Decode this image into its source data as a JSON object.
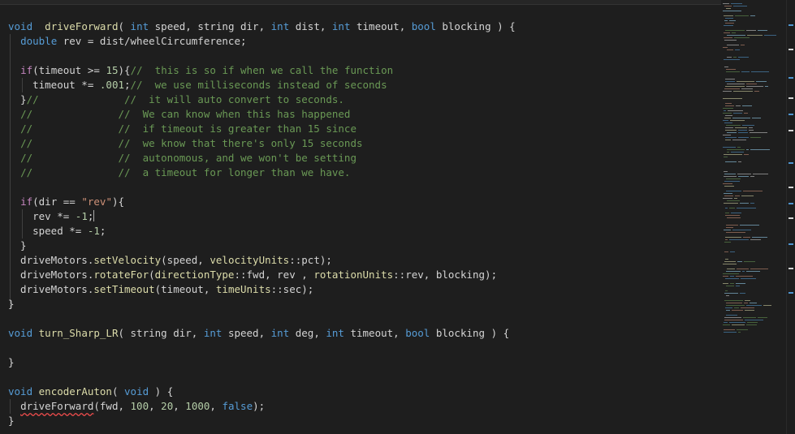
{
  "editor": {
    "language": "cpp",
    "lines": [
      [
        [
          "kw",
          "void"
        ],
        [
          "",
          "  "
        ],
        [
          "fn",
          "driveForward"
        ],
        [
          "",
          "( "
        ],
        [
          "kw",
          "int"
        ],
        [
          "",
          " speed, string dir, "
        ],
        [
          "kw",
          "int"
        ],
        [
          "",
          " dist, "
        ],
        [
          "kw",
          "int"
        ],
        [
          "",
          " timeout, "
        ],
        [
          "kw",
          "bool"
        ],
        [
          "",
          " blocking ) {"
        ]
      ],
      [
        [
          "",
          "  "
        ],
        [
          "kw",
          "double"
        ],
        [
          "",
          " rev = dist/wheelCircumference;"
        ]
      ],
      [],
      [
        [
          "",
          "  "
        ],
        [
          "ctl",
          "if"
        ],
        [
          "",
          "(timeout >= "
        ],
        [
          "num",
          "15"
        ],
        [
          "",
          "){"
        ],
        [
          "cmt",
          "//  this is so if when we call the function"
        ]
      ],
      [
        [
          "",
          "    timeout *= "
        ],
        [
          "num",
          ".001"
        ],
        [
          "",
          ";"
        ],
        [
          "cmt",
          "//  we use milliseconds instead of seconds"
        ]
      ],
      [
        [
          "",
          "  }"
        ],
        [
          "cmt",
          "//              //  it will auto convert to seconds."
        ]
      ],
      [
        [
          "",
          "  "
        ],
        [
          "cmt",
          "//              //  We can know when this has happened"
        ]
      ],
      [
        [
          "",
          "  "
        ],
        [
          "cmt",
          "//              //  if timeout is greater than 15 since"
        ]
      ],
      [
        [
          "",
          "  "
        ],
        [
          "cmt",
          "//              //  we know that there's only 15 seconds"
        ]
      ],
      [
        [
          "",
          "  "
        ],
        [
          "cmt",
          "//              //  autonomous, and we won't be setting"
        ]
      ],
      [
        [
          "",
          "  "
        ],
        [
          "cmt",
          "//              //  a timeout for longer than we have."
        ]
      ],
      [],
      [
        [
          "",
          "  "
        ],
        [
          "ctl",
          "if"
        ],
        [
          "",
          "(dir == "
        ],
        [
          "str",
          "\"rev\""
        ],
        [
          "",
          "){"
        ]
      ],
      [
        [
          "",
          "    rev *= "
        ],
        [
          "num",
          "-1"
        ],
        [
          "",
          ";"
        ],
        [
          "cursor",
          ""
        ]
      ],
      [
        [
          "",
          "    speed *= "
        ],
        [
          "num",
          "-1"
        ],
        [
          "",
          ";"
        ]
      ],
      [
        [
          "",
          "  }"
        ]
      ],
      [
        [
          "",
          "  driveMotors."
        ],
        [
          "fn",
          "setVelocity"
        ],
        [
          "",
          "(speed, "
        ],
        [
          "enm",
          "velocityUnits"
        ],
        [
          "",
          "::pct);"
        ]
      ],
      [
        [
          "",
          "  driveMotors."
        ],
        [
          "fn",
          "rotateFor"
        ],
        [
          "",
          "("
        ],
        [
          "enm",
          "directionType"
        ],
        [
          "",
          "::fwd, rev , "
        ],
        [
          "enm",
          "rotationUnits"
        ],
        [
          "",
          "::rev, blocking);"
        ]
      ],
      [
        [
          "",
          "  driveMotors."
        ],
        [
          "fn",
          "setTimeout"
        ],
        [
          "",
          "(timeout, "
        ],
        [
          "enm",
          "timeUnits"
        ],
        [
          "",
          "::sec);"
        ]
      ],
      [
        [
          "",
          "}"
        ]
      ],
      [],
      [
        [
          "kw",
          "void"
        ],
        [
          "",
          " "
        ],
        [
          "fn",
          "turn_Sharp_LR"
        ],
        [
          "",
          "( string dir, "
        ],
        [
          "kw",
          "int"
        ],
        [
          "",
          " speed, "
        ],
        [
          "kw",
          "int"
        ],
        [
          "",
          " deg, "
        ],
        [
          "kw",
          "int"
        ],
        [
          "",
          " timeout, "
        ],
        [
          "kw",
          "bool"
        ],
        [
          "",
          " blocking ) {"
        ]
      ],
      [],
      [
        [
          "",
          "}"
        ]
      ],
      [],
      [
        [
          "kw",
          "void"
        ],
        [
          "",
          " "
        ],
        [
          "fn",
          "encoderAuton"
        ],
        [
          "",
          "( "
        ],
        [
          "kw",
          "void"
        ],
        [
          "",
          " ) {"
        ]
      ],
      [
        [
          "",
          "  "
        ],
        [
          "squiggle",
          "driveForward"
        ],
        [
          "",
          "(fwd, "
        ],
        [
          "num",
          "100"
        ],
        [
          "",
          ", "
        ],
        [
          "num",
          "20"
        ],
        [
          "",
          ", "
        ],
        [
          "num",
          "1000"
        ],
        [
          "",
          ", "
        ],
        [
          "kw",
          "false"
        ],
        [
          "",
          ");"
        ]
      ],
      [
        [
          "",
          "}"
        ]
      ]
    ]
  },
  "minimap": {
    "colors": [
      "#569cd6",
      "#6a9955",
      "#d4d4d4",
      "#dcdcaa",
      "#ce9178",
      "#9cdcfe"
    ]
  },
  "scrollbar": {
    "marker_colors": [
      "#4e94ce",
      "#d4d4d4"
    ]
  }
}
